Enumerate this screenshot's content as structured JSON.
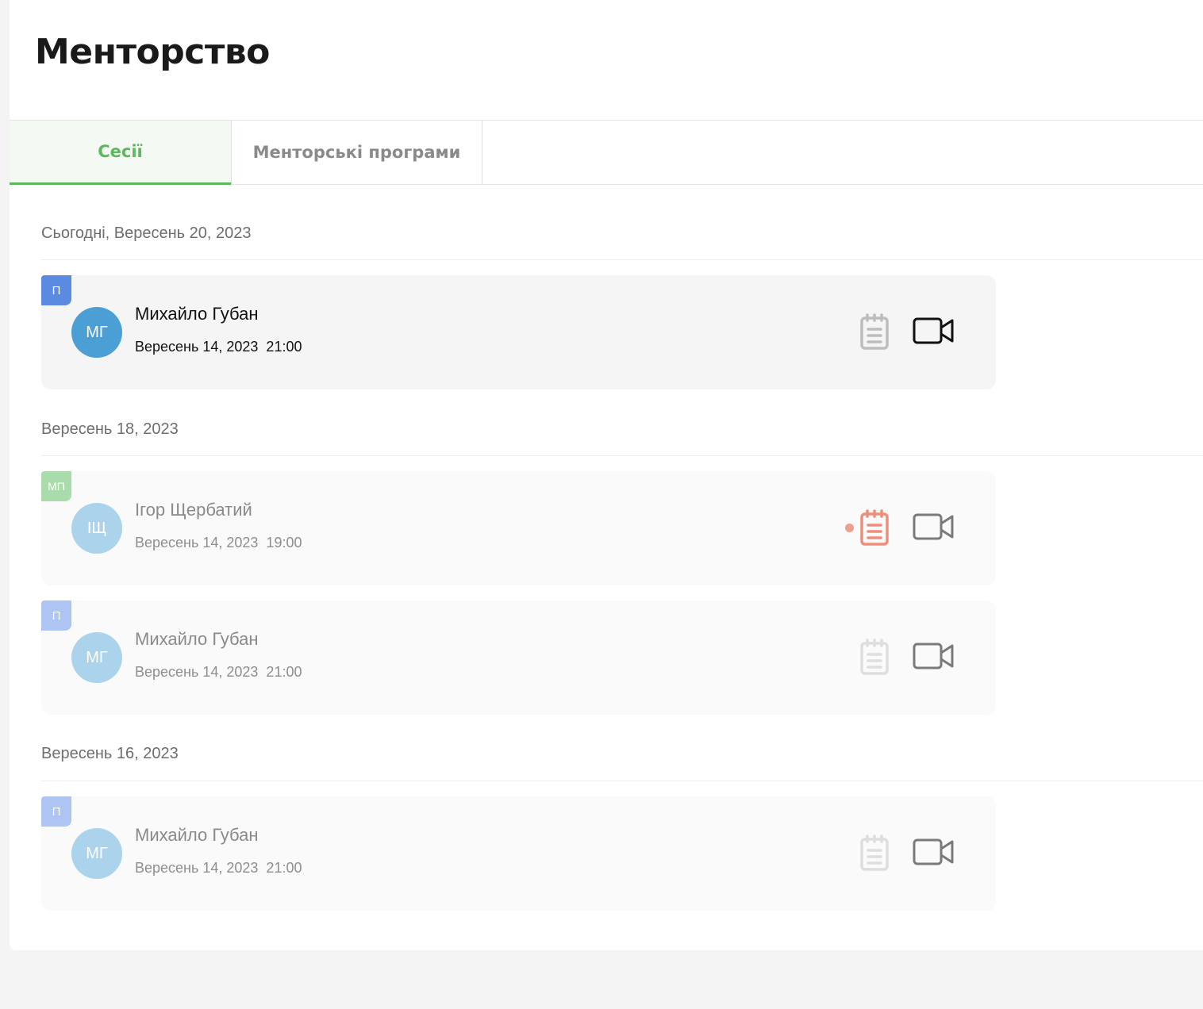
{
  "page": {
    "title": "Менторство"
  },
  "tabs": [
    {
      "label": "Сесії",
      "active": true
    },
    {
      "label": "Менторські програми",
      "active": false
    }
  ],
  "colors": {
    "accent_green": "#5cb85c",
    "badge_blue": "#5b8be0",
    "badge_green": "#a9dcaa",
    "avatar_blue": "#4b9fd5",
    "note_highlight": "#ec8e7a"
  },
  "groups": [
    {
      "date": "Сьогодні, Вересень 20, 2023",
      "sessions": [
        {
          "badge": "П",
          "initials": "МГ",
          "name": "Михайло Губан",
          "time": "Вересень 14, 2023  21:00",
          "notes_icon": "notepad-icon",
          "video_icon": "video-camera-icon"
        }
      ]
    },
    {
      "date": "Вересень 18, 2023",
      "sessions": [
        {
          "badge": "МП",
          "initials": "ІЩ",
          "name": "Ігор Щербатий",
          "time": "Вересень 14, 2023  19:00",
          "notes_icon": "notepad-icon",
          "video_icon": "video-camera-icon",
          "has_unread_note": true
        },
        {
          "badge": "П",
          "initials": "МГ",
          "name": "Михайло Губан",
          "time": "Вересень 14, 2023  21:00",
          "notes_icon": "notepad-icon",
          "video_icon": "video-camera-icon"
        }
      ]
    },
    {
      "date": "Вересень 16, 2023",
      "sessions": [
        {
          "badge": "П",
          "initials": "МГ",
          "name": "Михайло Губан",
          "time": "Вересень 14, 2023  21:00",
          "notes_icon": "notepad-icon",
          "video_icon": "video-camera-icon"
        }
      ]
    }
  ]
}
